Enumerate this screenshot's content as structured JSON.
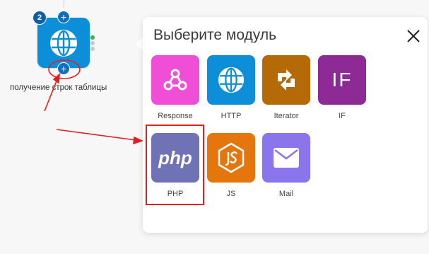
{
  "node": {
    "badge": "2",
    "plus_top": "+",
    "plus_bottom": "+",
    "label": "получение строк таблицы",
    "icon": "globe-icon",
    "color": "#0d8ed9"
  },
  "popup": {
    "title": "Выберите модуль",
    "close_icon": "close-icon"
  },
  "modules": [
    {
      "label": "Response",
      "icon": "webhook-icon",
      "color": "#f04ed6"
    },
    {
      "label": "HTTP",
      "icon": "globe-icon",
      "color": "#0d8ed9"
    },
    {
      "label": "Iterator",
      "icon": "iterator-icon",
      "color": "#b56a08"
    },
    {
      "label": "IF",
      "icon_text": "IF",
      "color": "#8e2a96"
    },
    {
      "label": "PHP",
      "icon_text": "php",
      "color": "#6f73b6"
    },
    {
      "label": "JS",
      "icon": "js-icon",
      "color": "#e5760e"
    },
    {
      "label": "Mail",
      "icon": "mail-icon",
      "color": "#8a75ec"
    }
  ],
  "annotation": {
    "highlight_color": "#e02020"
  }
}
